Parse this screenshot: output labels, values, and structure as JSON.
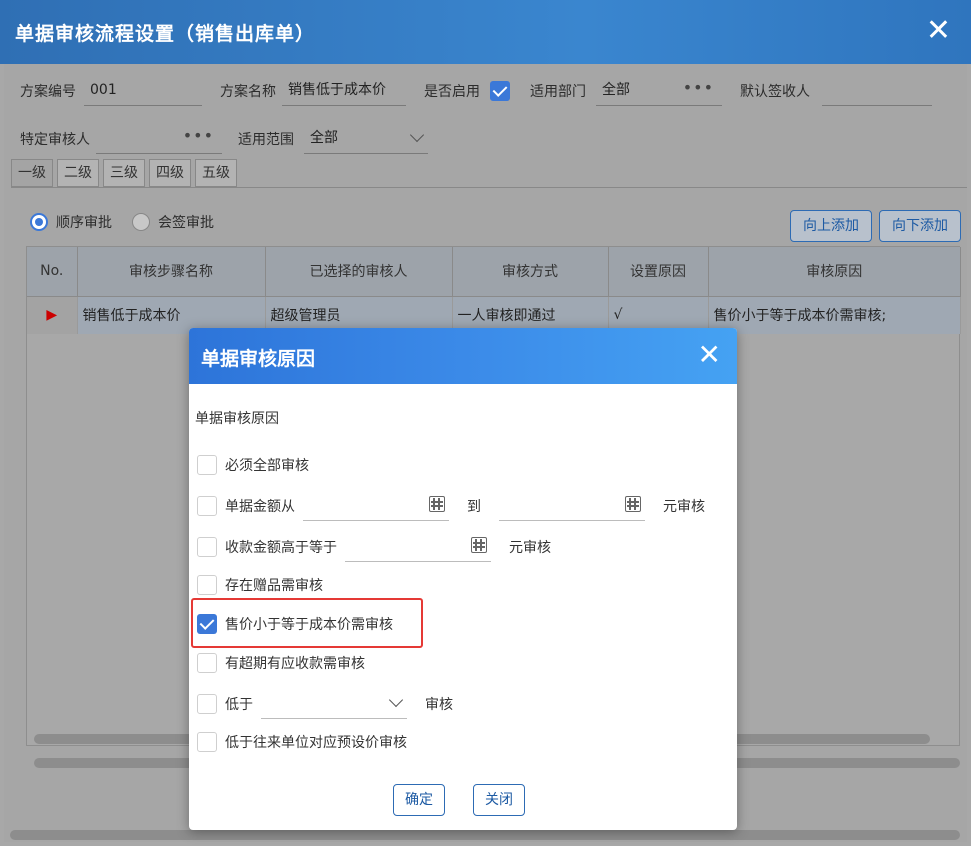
{
  "window": {
    "title": "单据审核流程设置（销售出库单）",
    "close_glyph": "✕"
  },
  "form": {
    "scheme_no_label": "方案编号",
    "scheme_no_value": "001",
    "scheme_name_label": "方案名称",
    "scheme_name_value": "销售低于成本价",
    "enabled_label": "是否启用",
    "enabled": true,
    "dept_label": "适用部门",
    "dept_value": "全部",
    "default_signer_label": "默认签收人",
    "specific_reviewer_label": "特定审核人",
    "scope_label": "适用范围",
    "scope_value": "全部",
    "ellipsis": "•••"
  },
  "tabs": [
    "一级",
    "二级",
    "三级",
    "四级",
    "五级"
  ],
  "approval_mode": {
    "sequential_label": "顺序审批",
    "countersign_label": "会签审批",
    "selected": "sequential"
  },
  "actions": {
    "add_above": "向上添加",
    "add_below": "向下添加"
  },
  "grid": {
    "columns": [
      "No.",
      "审核步骤名称",
      "已选择的审核人",
      "审核方式",
      "设置原因",
      "审核原因"
    ],
    "rows": [
      {
        "marker": "▶",
        "step_name": "销售低于成本价",
        "reviewers": "超级管理员",
        "method": "一人审核即通过",
        "set_reason": "√",
        "reason": "售价小于等于成本价需审核;"
      }
    ]
  },
  "modal": {
    "title": "单据审核原因",
    "close_glyph": "✕",
    "subtitle": "单据审核原因",
    "options": {
      "all_review": {
        "label": "必须全部审核",
        "checked": false
      },
      "amount_range": {
        "label": "单据金额从",
        "to_label": "到",
        "suffix": "元审核",
        "checked": false
      },
      "receipt_amount": {
        "label": "收款金额高于等于",
        "suffix": "元审核",
        "checked": false
      },
      "gift": {
        "label": "存在赠品需审核",
        "checked": false
      },
      "below_cost": {
        "label": "售价小于等于成本价需审核",
        "checked": true
      },
      "overdue": {
        "label": "有超期有应收款需审核",
        "checked": false
      },
      "lower_than": {
        "label": "低于",
        "suffix": "审核",
        "checked": false
      },
      "preset_price": {
        "label": "低于往来单位对应预设价审核",
        "checked": false
      }
    },
    "confirm": "确定",
    "close": "关闭"
  },
  "colors": {
    "accent": "#3b78d8",
    "title_bar": "#3a86cf",
    "highlight": "#e53935"
  }
}
